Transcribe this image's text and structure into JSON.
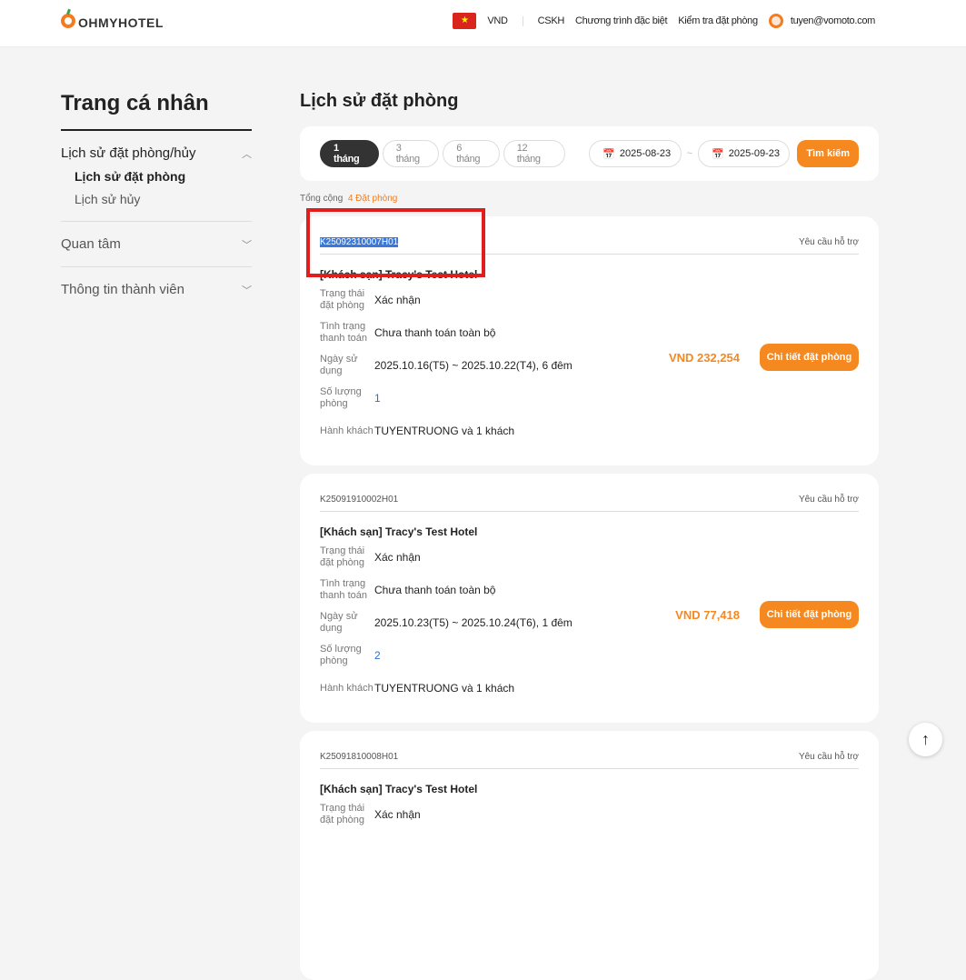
{
  "header": {
    "logo": "OHMYHOTEL",
    "currency": "VND",
    "nav": [
      "CSKH",
      "Chương trình đặc biệt",
      "Kiểm tra đặt phòng"
    ],
    "user": "tuyen@vomoto.com"
  },
  "sidebar": {
    "title": "Trang cá nhân",
    "sections": [
      {
        "label": "Lịch sử đặt phòng/hủy",
        "subs": [
          "Lịch sử đặt phòng",
          "Lịch sử hủy"
        ]
      },
      {
        "label": "Quan tâm"
      },
      {
        "label": "Thông tin thành viên"
      }
    ]
  },
  "main": {
    "title": "Lịch sử đặt phòng",
    "periods": [
      "1 tháng",
      "3 tháng",
      "6 tháng",
      "12 tháng"
    ],
    "date_from": "2025-08-23",
    "date_to": "2025-09-23",
    "search": "Tìm kiếm",
    "total_label": "Tổng cộng",
    "total_count": "4 Đặt phòng"
  },
  "labels": {
    "support": "Yêu cầu hỗ trợ",
    "status": "Trạng thái đặt phòng",
    "payment": "Tình trạng thanh toán",
    "dates": "Ngày sử dụng",
    "rooms": "Số lượng phòng",
    "guests": "Hành khách",
    "detail": "Chi tiết đặt phòng"
  },
  "bookings": [
    {
      "code": "K25092310007H01",
      "hotel": "[Khách sạn] Tracy's Test Hotel",
      "status": "Xác nhận",
      "payment": "Chưa thanh toán toàn bộ",
      "dates": "2025.10.16(T5) ~ 2025.10.22(T4), 6 đêm",
      "rooms": "1",
      "guests": "TUYENTRUONG và 1 khách",
      "price": "VND 232,254"
    },
    {
      "code": "K25091910002H01",
      "hotel": "[Khách sạn] Tracy's Test Hotel",
      "status": "Xác nhận",
      "payment": "Chưa thanh toán toàn bộ",
      "dates": "2025.10.23(T5) ~ 2025.10.24(T6), 1 đêm",
      "rooms": "2",
      "guests": "TUYENTRUONG và 1 khách",
      "price": "VND 77,418"
    },
    {
      "code": "K25091810008H01",
      "hotel": "[Khách sạn] Tracy's Test Hotel",
      "status": "Xác nhận"
    }
  ]
}
